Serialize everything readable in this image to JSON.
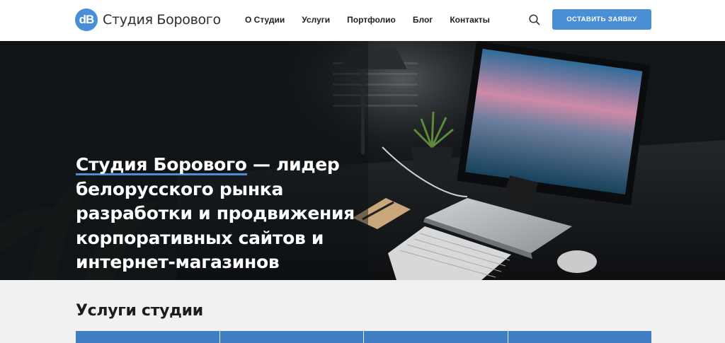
{
  "header": {
    "logo_mark": "dB",
    "logo_text": "Студия Борового",
    "nav": [
      "О Студии",
      "Услуги",
      "Портфолио",
      "Блог",
      "Контакты"
    ],
    "search_icon": "search-icon",
    "cta_label": "ОСТАВИТЬ ЗАЯВКУ"
  },
  "hero": {
    "title_accent": "Студия Борового",
    "title_rest": " — лидер белорусского рынка разработки и продвижения корпоративных сайтов и интернет-магазинов"
  },
  "services": {
    "title": "Услуги студии",
    "cards_count_visible": 4
  },
  "colors": {
    "accent": "#4a8fd6",
    "hero_bg": "#131619",
    "section_bg": "#f1f1f1"
  }
}
